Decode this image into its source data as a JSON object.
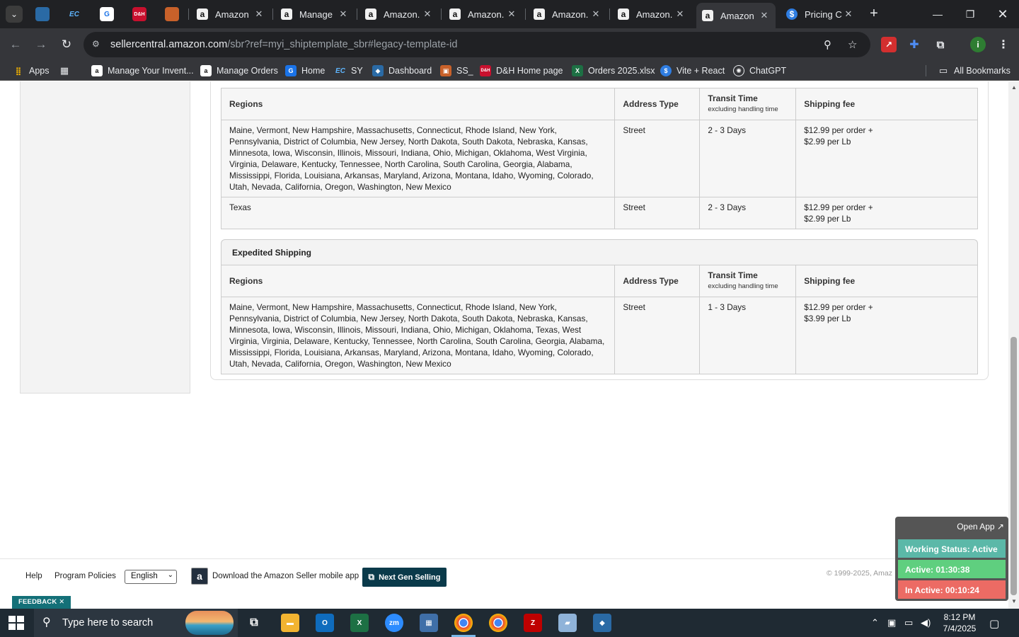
{
  "browser": {
    "tabs": [
      {
        "label": "Amazon",
        "favicon": "amazon-icon",
        "active": false
      },
      {
        "label": "Manage",
        "favicon": "amazon-icon",
        "active": false
      },
      {
        "label": "Amazon.",
        "favicon": "amazon-icon",
        "active": false
      },
      {
        "label": "Amazon.",
        "favicon": "amazon-icon",
        "active": false
      },
      {
        "label": "Amazon.",
        "favicon": "amazon-icon",
        "active": false
      },
      {
        "label": "Amazon.",
        "favicon": "amazon-icon",
        "active": false
      },
      {
        "label": "Amazon",
        "favicon": "amazon-icon",
        "active": true
      },
      {
        "label": "Pricing C",
        "favicon": "dollar-icon",
        "active": false
      }
    ],
    "pinned_tabs": [
      {
        "label": "",
        "icon": "blue-diamond-icon"
      },
      {
        "label": "EC",
        "icon": "ec-icon"
      },
      {
        "label": "G",
        "icon": "google-g-icon"
      },
      {
        "label": "D&H",
        "icon": "dh-icon"
      },
      {
        "label": "",
        "icon": "box-icon"
      }
    ],
    "url_host": "sellercentral.amazon.com",
    "url_path": "/sbr?ref=myi_shiptemplate_sbr#legacy-template-id",
    "profile_initial": "i",
    "bookmarks": [
      {
        "label": "Apps",
        "icon": "apps-grid-icon"
      },
      {
        "label": "",
        "icon": "tab-groups-icon"
      },
      {
        "label": "Manage Your Invent...",
        "icon": "amazon-icon"
      },
      {
        "label": "Manage Orders",
        "icon": "amazon-icon"
      },
      {
        "label": "Home",
        "icon": "google-g-icon"
      },
      {
        "label": "SY",
        "icon": "ec-icon"
      },
      {
        "label": "Dashboard",
        "icon": "blue-diamond-icon"
      },
      {
        "label": "SS_",
        "icon": "box-icon"
      },
      {
        "label": "D&H Home page",
        "icon": "dh-icon"
      },
      {
        "label": "Orders 2025.xlsx",
        "icon": "excel-icon"
      },
      {
        "label": "Vite + React",
        "icon": "dollar-icon"
      },
      {
        "label": "ChatGPT",
        "icon": "chatgpt-icon"
      }
    ],
    "all_bookmarks": "All Bookmarks"
  },
  "standard_table": {
    "headers": {
      "regions": "Regions",
      "address_type": "Address Type",
      "transit_time": "Transit Time",
      "transit_sub": "excluding handling time",
      "shipping_fee": "Shipping fee"
    },
    "rows": [
      {
        "regions": "Maine, Vermont, New Hampshire, Massachusetts, Connecticut, Rhode Island, New York, Pennsylvania, District of Columbia, New Jersey, North Dakota, South Dakota, Nebraska, Kansas, Minnesota, Iowa, Wisconsin, Illinois, Missouri, Indiana, Ohio, Michigan, Oklahoma, West Virginia, Virginia, Delaware, Kentucky, Tennessee, North Carolina, South Carolina, Georgia, Alabama, Mississippi, Florida, Louisiana, Arkansas, Maryland, Arizona, Montana, Idaho, Wyoming, Colorado, Utah, Nevada, California, Oregon, Washington, New Mexico",
        "address_type": "Street",
        "transit_time": "2 - 3 Days",
        "fee_line1": "$12.99 per order +",
        "fee_line2": "$2.99 per Lb"
      },
      {
        "regions": "Texas",
        "address_type": "Street",
        "transit_time": "2 - 3 Days",
        "fee_line1": "$12.99 per order +",
        "fee_line2": "$2.99 per Lb"
      }
    ]
  },
  "expedited": {
    "section_title": "Expedited Shipping",
    "headers": {
      "regions": "Regions",
      "address_type": "Address Type",
      "transit_time": "Transit Time",
      "transit_sub": "excluding handling time",
      "shipping_fee": "Shipping fee"
    },
    "rows": [
      {
        "regions": "Maine, Vermont, New Hampshire, Massachusetts, Connecticut, Rhode Island, New York, Pennsylvania, District of Columbia, New Jersey, North Dakota, South Dakota, Nebraska, Kansas, Minnesota, Iowa, Wisconsin, Illinois, Missouri, Indiana, Ohio, Michigan, Oklahoma, Texas, West Virginia, Virginia, Delaware, Kentucky, Tennessee, North Carolina, South Carolina, Georgia, Alabama, Mississippi, Florida, Louisiana, Arkansas, Maryland, Arizona, Montana, Idaho, Wyoming, Colorado, Utah, Nevada, California, Oregon, Washington, New Mexico",
        "address_type": "Street",
        "transit_time": "1 - 3 Days",
        "fee_line1": "$12.99 per order +",
        "fee_line2": "$3.99 per Lb"
      }
    ]
  },
  "footer": {
    "help": "Help",
    "program_policies": "Program Policies",
    "language": "English",
    "download_app": "Download the Amazon Seller mobile app",
    "next_gen": "Next Gen Selling",
    "copyright": "© 1999-2025, Amaz"
  },
  "feedback": {
    "label": "FEEDBACK ✕"
  },
  "status_widget": {
    "open_app": "Open App ↗",
    "working_status": "Working Status: Active",
    "active": "Active: 01:30:38",
    "inactive": "In Active: 00:10:24",
    "colors": {
      "working": "#5bb8a8",
      "active": "#5fcf7f",
      "inactive": "#ec6b64"
    }
  },
  "taskbar": {
    "search_placeholder": "Type here to search",
    "time": "8:12 PM",
    "date": "7/4/2025",
    "apps": [
      "task-view-icon",
      "file-explorer-icon",
      "outlook-icon",
      "excel-icon",
      "zoom-icon",
      "calculator-icon",
      "chrome-icon",
      "chrome-profile-icon",
      "filezilla-icon",
      "notes-icon",
      "blue-diamond-icon"
    ]
  }
}
